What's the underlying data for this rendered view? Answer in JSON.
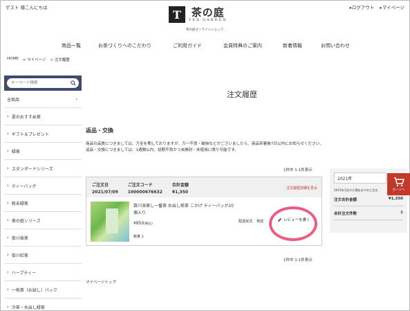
{
  "header": {
    "greeting": "ゲスト 様こんにちは",
    "logout": "▸ログアウト",
    "mypage": "▸マイページ",
    "logo_mark": "T",
    "logo_jp": "茶の庭",
    "logo_en": "TEA GARDEN",
    "logo_sub": "茶の庭オンラインショップ"
  },
  "nav": {
    "items": [
      "商品一覧",
      "お茶づくりへのこだわり",
      "ご利用ガイド",
      "会員特典のご案内",
      "新着情報",
      "お問い合わせ"
    ]
  },
  "breadcrumb": [
    "HOME",
    "> マイページ",
    "> 注文履歴"
  ],
  "sidebar": {
    "search_placeholder": "キーワード検索",
    "all_label": "全商品",
    "categories": [
      "夏のおすすめ茶",
      "ギフト＆プレゼント",
      "緑茶",
      "スタンダードシリーズ",
      "ティーバッグ",
      "粉末緑茶",
      "茶の庭シリーズ",
      "掛川抹茶",
      "掛川紅茶",
      "ハーブティー",
      "一煎茶（お試し）パック",
      "冷茶・水出し緑茶"
    ]
  },
  "main": {
    "title": "注文履歴",
    "section_heading": "返品・交換",
    "notice_line1": "商品の品質につきましては、万全を期しておりますが、万一不良・破損などがございましたら、商品到着後7日以内にお知らせください。",
    "notice_line2": "返品・交換につきましては、1週間以内、初期不良かつ未開封・未使用に限り可能です。",
    "count_top": "1件中 1-1件表示",
    "count_bottom": "1件中 1-1件表示",
    "mypage_top": "マイページトップ"
  },
  "order": {
    "date_label": "ご注文日",
    "date": "2021/07/09",
    "code_label": "ご注文コード",
    "code": "100000676632",
    "total_label": "合計金額",
    "total": "¥1,350",
    "detail_link": "注文履歴詳細を見る",
    "product_name": "掛川深蒸し一番茶 水出し煎茶 こかげ ティーバッグ20個入り",
    "price": "¥850",
    "price_tax": "(税込)",
    "qty": "数量 1",
    "ship_label": "配送状況",
    "ship_value": "発送",
    "review_label": "レビューを書く"
  },
  "summary": {
    "year": "2021年",
    "range": "2021年1月から現在までのご注文",
    "total_label": "注文合計金額",
    "total": "¥1,350",
    "count_label": "合計注文件数",
    "count": "1"
  },
  "cart": {
    "label": "カートへ"
  },
  "colors": {
    "accent": "#c0392b",
    "search_bg": "#3f4b6b",
    "highlight": "#e95d7f"
  }
}
